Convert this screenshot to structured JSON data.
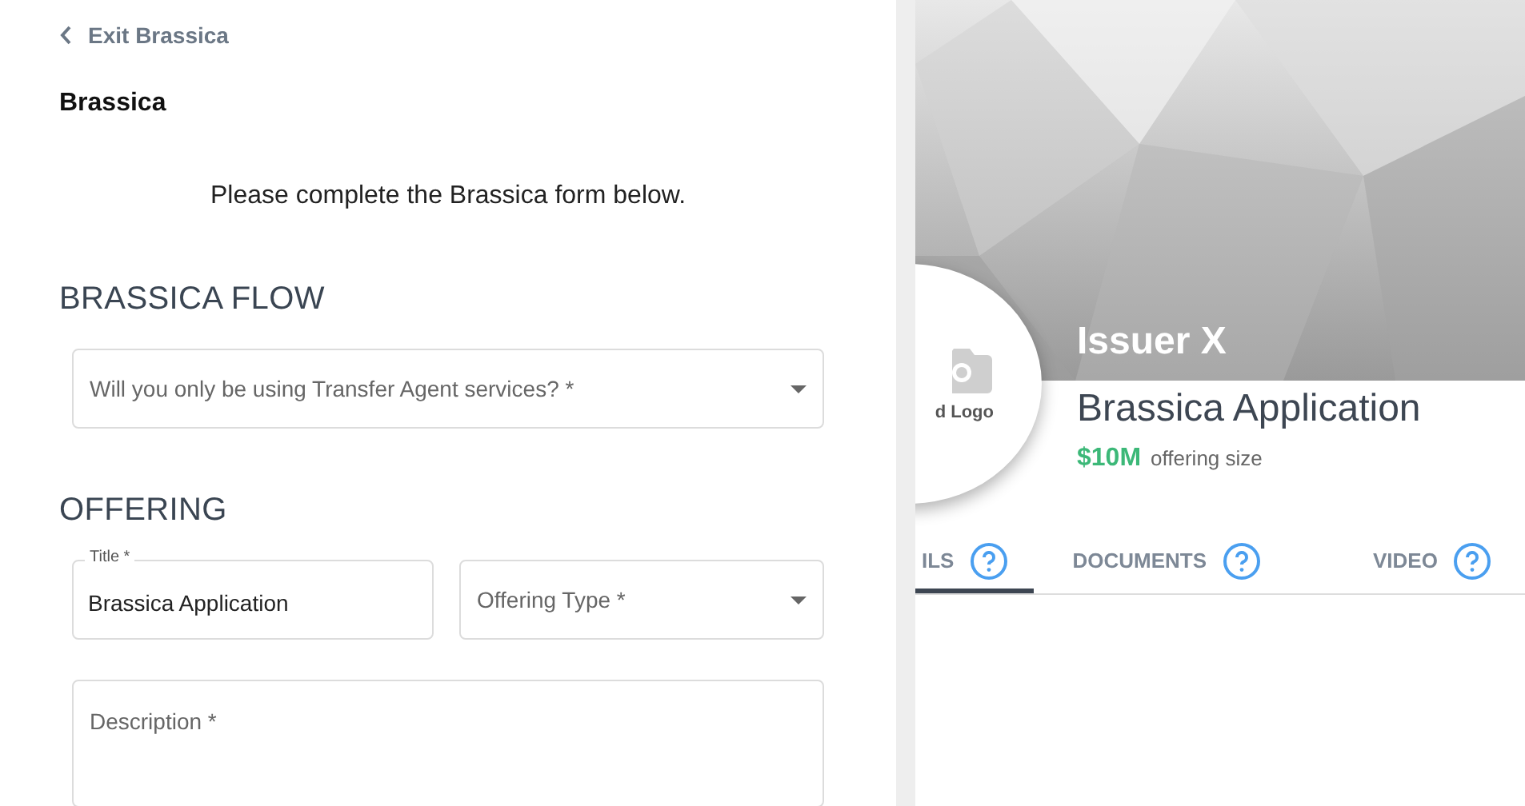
{
  "back_link": "Exit Brassica",
  "form_title": "Brassica",
  "intro": "Please complete the Brassica form below.",
  "sections": [
    {
      "heading": "BRASSICA FLOW",
      "rows": [
        [
          {
            "kind": "select",
            "placeholder": "Will you only be using Transfer Agent services? *"
          }
        ]
      ]
    },
    {
      "heading": "OFFERING",
      "rows": [
        [
          {
            "kind": "text",
            "label": "Title *",
            "value": "Brassica Application"
          },
          {
            "kind": "select",
            "placeholder": "Offering Type *"
          }
        ],
        [
          {
            "kind": "textarea",
            "placeholder": "Description *"
          }
        ]
      ]
    }
  ],
  "profile": {
    "logo_label": "d Logo",
    "issuer": "Issuer X",
    "subtitle": "Brassica Application",
    "amount": "$10M",
    "amount_label": "offering size"
  },
  "tabs": [
    {
      "label": "ILS",
      "selected": true
    },
    {
      "label": "DOCUMENTS",
      "selected": false
    },
    {
      "label": "VIDEO",
      "selected": false
    }
  ]
}
